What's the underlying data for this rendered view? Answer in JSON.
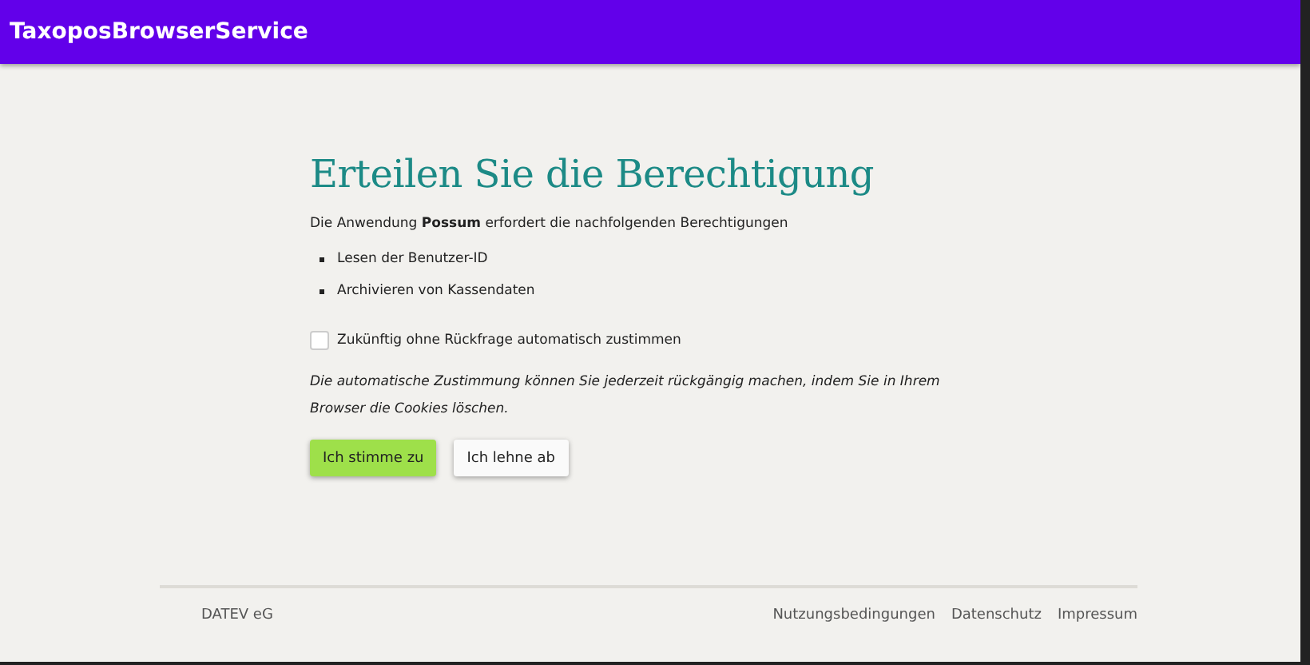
{
  "app_bar": {
    "title": "TaxoposBrowserService"
  },
  "consent": {
    "heading": "Erteilen Sie die Berechtigung",
    "intro": "Die Anwendung **Possum** erfordert die nachfolgenden Berechtigungen",
    "permissions": [
      "Lesen der Benutzer-ID",
      "Archivieren von Kassendaten"
    ],
    "auto_consent": {
      "label": "Zukünftig ohne Rückfrage automatisch zustimmen",
      "checked": false
    },
    "note": "Die automatische Zustimmung können Sie jederzeit rückgängig machen, indem Sie in Ihrem Browser die Cookies löschen.",
    "buttons": [
      {
        "label": "Ich stimme zu",
        "kind": "primary"
      },
      {
        "label": "Ich lehne ab",
        "kind": "secondary"
      }
    ]
  },
  "footer": {
    "company": "DATEV eG",
    "links": [
      "Nutzungsbedingungen",
      "Datenschutz",
      "Impressum"
    ]
  }
}
